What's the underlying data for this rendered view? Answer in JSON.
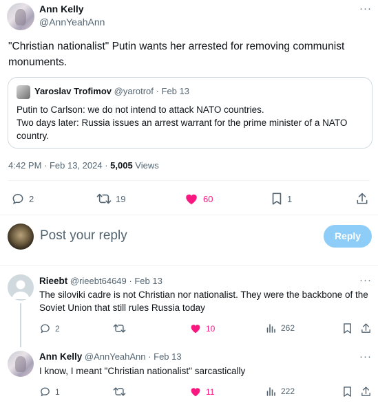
{
  "main_post": {
    "author": "Ann Kelly",
    "handle": "@AnnYeahAnn",
    "text": "\"Christian nationalist\" Putin wants her arrested for removing communist monuments.",
    "quote": {
      "author": "Yaroslav Trofimov",
      "handle": "@yarotrof",
      "sep": "·",
      "date": "Feb 13",
      "line1": "Putin to Carlson: we do not intend to attack NATO countries.",
      "line2": "Two days later: Russia issues an arrest warrant for the prime minister of a NATO country."
    },
    "meta": {
      "time": "4:42 PM · Feb 13, 2024 · ",
      "views_count": "5,005",
      "views_label": " Views"
    },
    "stats": {
      "replies": "2",
      "reposts": "19",
      "likes": "60",
      "bookmarks": "1"
    }
  },
  "compose": {
    "placeholder": "Post your reply",
    "button": "Reply"
  },
  "replies": [
    {
      "author": "Rieebt",
      "handle": "@rieebt64649",
      "sep": "·",
      "date": "Feb 13",
      "text": "The siloviki cadre is not Christian nor nationalist. They were the backbone of the Soviet Union that still rules Russia today",
      "stats": {
        "replies": "2",
        "reposts": "",
        "likes": "10",
        "views": "262"
      }
    },
    {
      "author": "Ann Kelly",
      "handle": "@AnnYeahAnn",
      "sep": "·",
      "date": "Feb 13",
      "text": "I know, I meant \"Christian nationalist\" sarcastically",
      "stats": {
        "replies": "1",
        "reposts": "",
        "likes": "11",
        "views": "222"
      }
    }
  ],
  "more_glyph": "···",
  "colors": {
    "like": "#f91880",
    "accent": "#1d9bf0",
    "reply_button": "#8ecdf8",
    "muted": "#536471"
  }
}
